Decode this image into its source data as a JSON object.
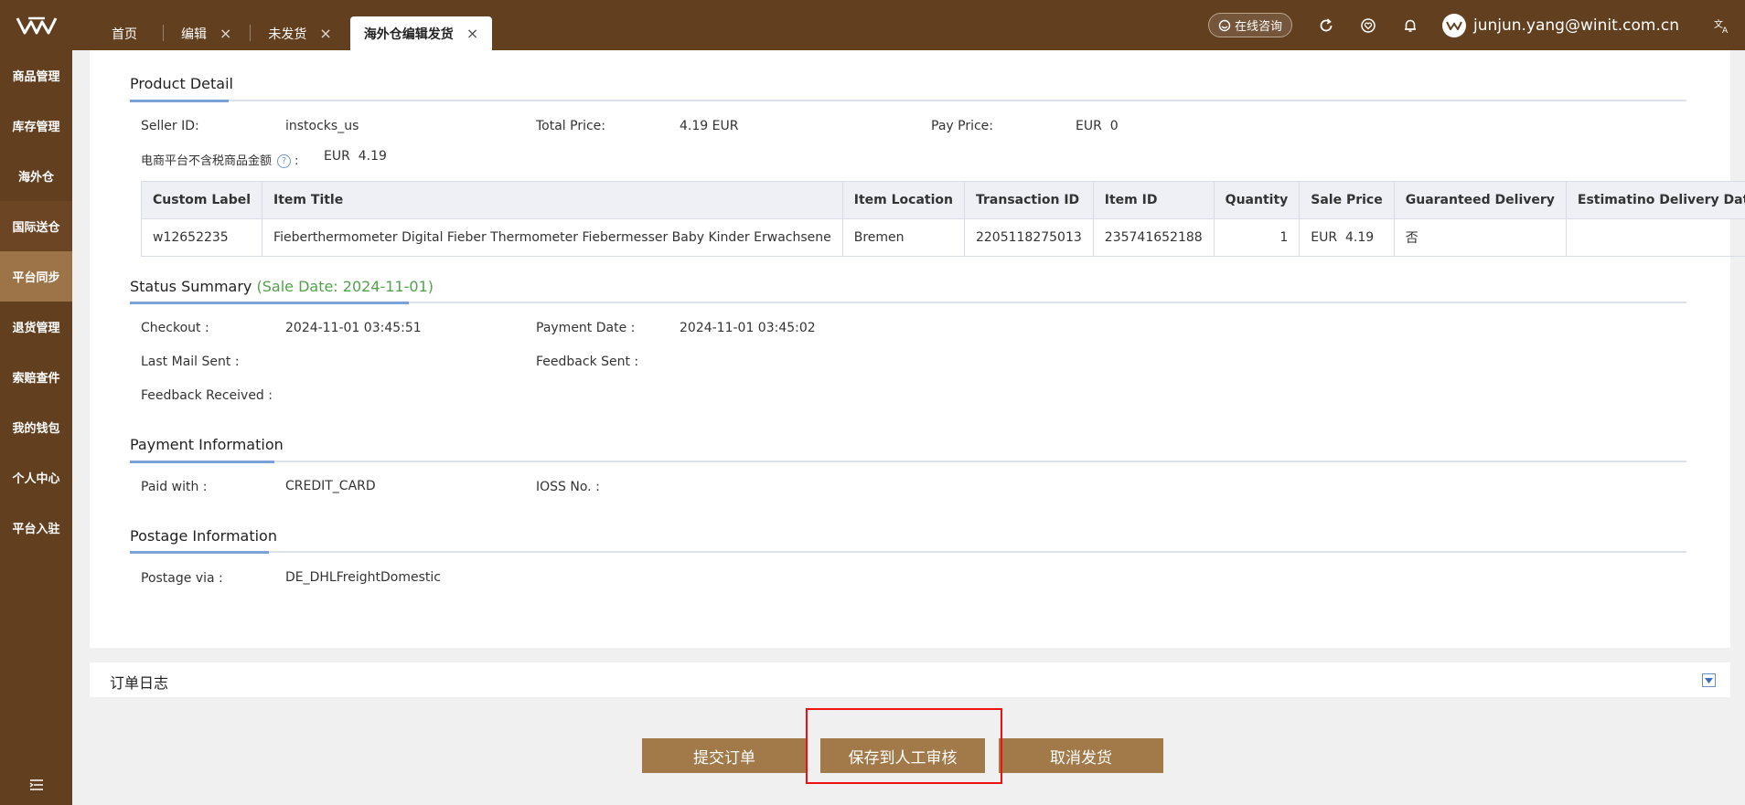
{
  "header": {
    "tabs": [
      {
        "label": "首页",
        "closable": false
      },
      {
        "label": "编辑",
        "closable": true
      },
      {
        "label": "未发货",
        "closable": true
      },
      {
        "label": "海外仓编辑发货",
        "closable": true,
        "active": true
      }
    ],
    "close_glyph": "×",
    "consult_label": "在线咨询",
    "user_email": "junjun.yang@winit.com.cn",
    "icons": [
      "refresh-icon",
      "heart-icon",
      "bell-icon",
      "translate-icon"
    ]
  },
  "sidebar": {
    "items": [
      {
        "label": "商品管理"
      },
      {
        "label": "库存管理"
      },
      {
        "label": "海外仓"
      },
      {
        "label": "国际送仓"
      },
      {
        "label": "平台同步"
      },
      {
        "label": "退货管理"
      },
      {
        "label": "索赔查件"
      },
      {
        "label": "我的钱包"
      },
      {
        "label": "个人中心"
      },
      {
        "label": "平台入驻"
      }
    ]
  },
  "product_detail": {
    "title": "Product Detail",
    "seller_id_label": "Seller ID:",
    "seller_id": "instocks_us",
    "total_price_label": "Total Price:",
    "total_price": "4.19 EUR",
    "pay_price_label": "Pay Price:",
    "pay_price": "EUR  0",
    "tax_label": "电商平台不含税商品金额",
    "help_glyph": "?",
    "colon": ":",
    "tax_value": "EUR  4.19",
    "table": {
      "headers": [
        "Custom Label",
        "Item Title",
        "Item Location",
        "Transaction ID",
        "Item ID",
        "Quantity",
        "Sale Price",
        "Guaranteed Delivery",
        "Estimatino Delivery Date"
      ],
      "rows": [
        [
          "w12652235",
          "Fieberthermometer Digital Fieber Thermometer Fiebermesser Baby Kinder Erwachsene",
          "Bremen",
          "2205118275013",
          "235741652188",
          "1",
          "EUR  4.19",
          "否",
          ""
        ]
      ]
    }
  },
  "status_summary": {
    "title": "Status Summary",
    "sale_date": "(Sale Date: 2024-11-01)",
    "checkout_label": "Checkout :",
    "checkout": "2024-11-01 03:45:51",
    "payment_date_label": "Payment Date :",
    "payment_date": "2024-11-01 03:45:02",
    "last_mail_label": "Last Mail Sent :",
    "feedback_sent_label": "Feedback Sent :",
    "feedback_received_label": "Feedback Received :"
  },
  "payment_info": {
    "title": "Payment Information",
    "paid_with_label": "Paid with :",
    "paid_with": "CREDIT_CARD",
    "ioss_label": "IOSS No. :"
  },
  "postage_info": {
    "title": "Postage Information",
    "postage_via_label": "Postage via :",
    "postage_via": "DE_DHLFreightDomestic"
  },
  "order_log": {
    "title": "订单日志"
  },
  "actions": {
    "submit": "提交订单",
    "save_review": "保存到人工审核",
    "cancel": "取消发货"
  },
  "colors": {
    "brand": "#623f1f",
    "accent_button": "#a27a4a",
    "sidebar_active": "#9c7447",
    "highlight": "#ee1111",
    "sale_date": "#52a24a"
  }
}
